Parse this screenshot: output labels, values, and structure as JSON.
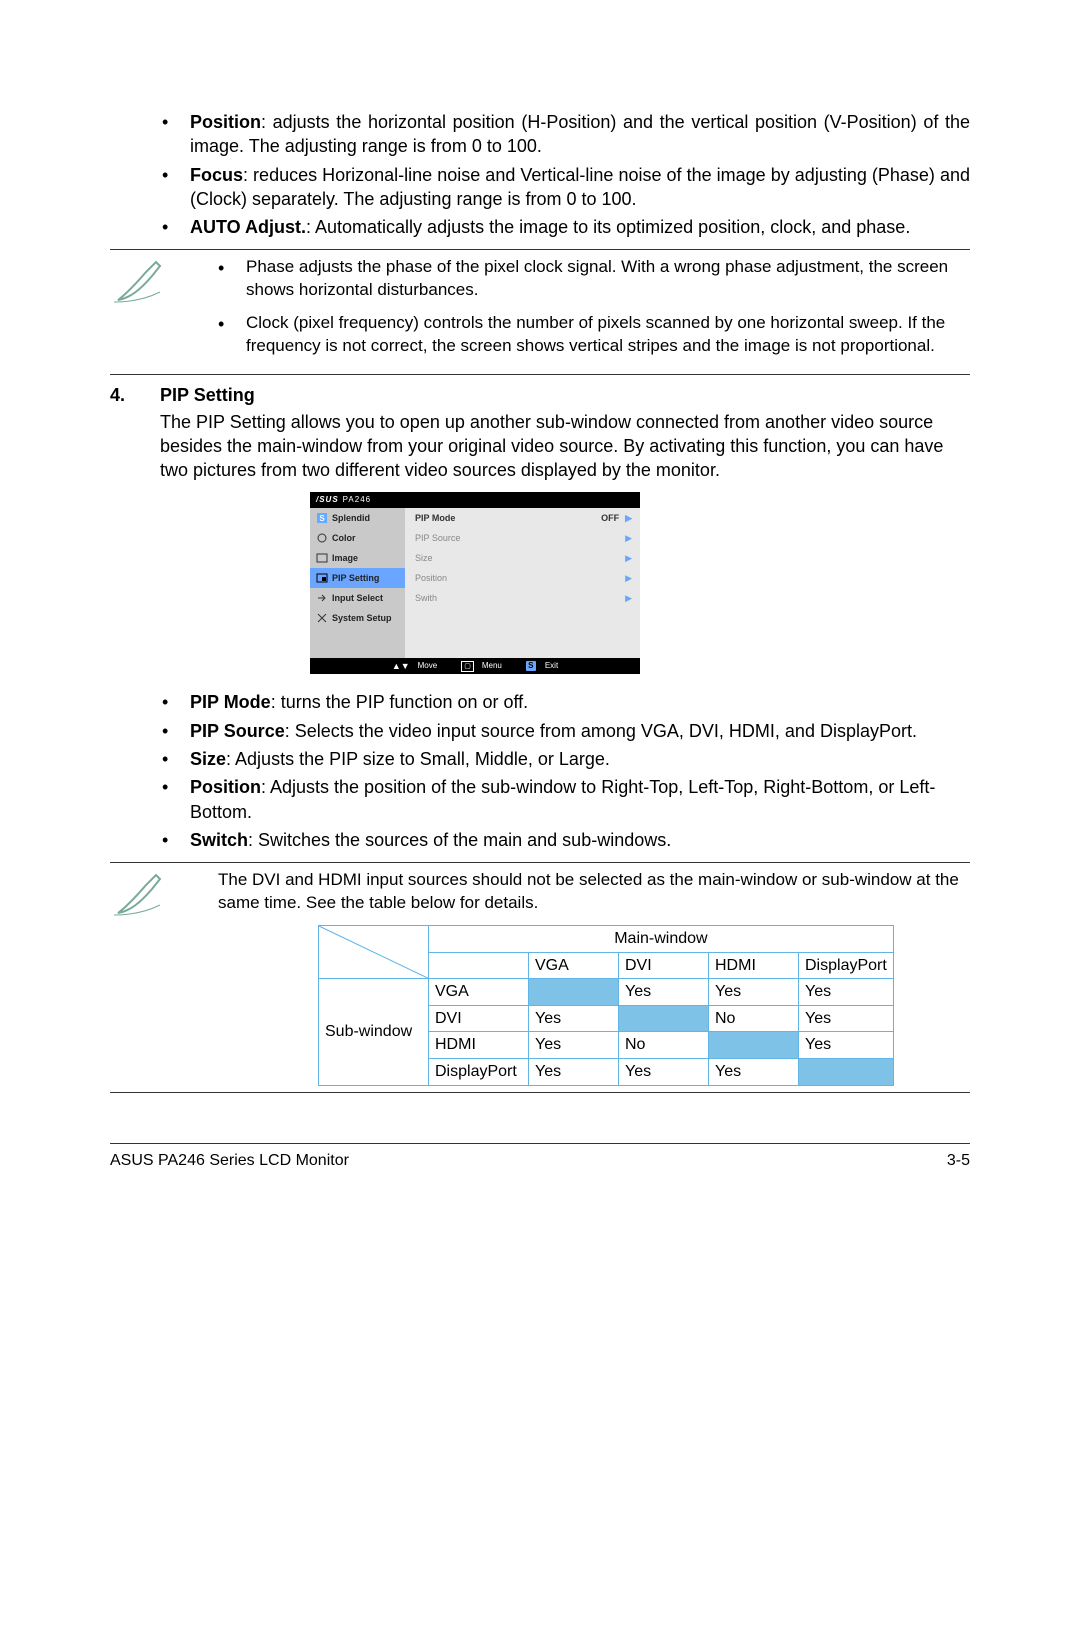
{
  "bullets1": [
    {
      "term": "Position",
      "text": ": adjusts the horizontal position (H-Position) and the vertical position (V-Position) of the image. The adjusting range is from 0 to 100."
    },
    {
      "term": "Focus",
      "text": ": reduces Horizonal-line noise and Vertical-line noise of the image by adjusting (Phase) and (Clock) separately. The adjusting range is from 0 to 100."
    },
    {
      "term": "AUTO Adjust.",
      "text": ": Automatically adjusts the image to its optimized position, clock, and phase."
    }
  ],
  "note1": [
    "Phase adjusts the phase of the pixel clock signal. With a wrong phase adjustment, the screen shows horizontal disturbances.",
    "Clock (pixel frequency) controls the number of pixels scanned by one horizontal sweep. If the frequency is not correct, the screen shows vertical stripes and the image is not proportional."
  ],
  "section": {
    "num": "4.",
    "title": "PIP Setting",
    "desc": "The PIP Setting allows you to open up another sub-window connected from another video source besides the main-window from your original video source. By activating this function, you can have two pictures from two different video sources displayed by the monitor."
  },
  "osd": {
    "brand": "/SUS",
    "model": "PA246",
    "left": [
      "Splendid",
      "Color",
      "Image",
      "PIP Setting",
      "Input Select",
      "System Setup"
    ],
    "selectedIndex": 3,
    "right": [
      {
        "label": "PIP Mode",
        "value": "OFF",
        "on": true
      },
      {
        "label": "PIP Source",
        "value": "",
        "on": false
      },
      {
        "label": "Size",
        "value": "",
        "on": false
      },
      {
        "label": "Position",
        "value": "",
        "on": false
      },
      {
        "label": "Swith",
        "value": "",
        "on": false
      }
    ],
    "bottom": {
      "move": "Move",
      "menu": "Menu",
      "exit": "Exit",
      "exitBadge": "S"
    }
  },
  "bullets2": [
    {
      "term": "PIP Mode",
      "text": ": turns the PIP function on or off."
    },
    {
      "term": "PIP Source",
      "text": ": Selects the video input source from among VGA, DVI, HDMI, and DisplayPort."
    },
    {
      "term": "Size",
      "text": ": Adjusts the PIP size to Small, Middle, or Large."
    },
    {
      "term": "Position",
      "text": ": Adjusts the position of the sub-window to Right-Top, Left-Top, Right-Bottom, or Left-Bottom."
    },
    {
      "term": "Switch",
      "text": ": Switches the sources of the main and sub-windows."
    }
  ],
  "note2": "The DVI and HDMI input sources should not be selected as the main-window or sub-window at the same time. See the table below for details.",
  "table": {
    "mainHeader": "Main-window",
    "subHeader": "Sub-window",
    "cols": [
      "VGA",
      "DVI",
      "HDMI",
      "DisplayPort"
    ],
    "rows": [
      {
        "name": "VGA",
        "cells": [
          "",
          "Yes",
          "Yes",
          "Yes"
        ],
        "fill": [
          0
        ]
      },
      {
        "name": "DVI",
        "cells": [
          "Yes",
          "",
          "No",
          "Yes"
        ],
        "fill": [
          1
        ]
      },
      {
        "name": "HDMI",
        "cells": [
          "Yes",
          "No",
          "",
          "Yes"
        ],
        "fill": [
          2
        ]
      },
      {
        "name": "DisplayPort",
        "cells": [
          "Yes",
          "Yes",
          "Yes",
          ""
        ],
        "fill": [
          3
        ]
      }
    ]
  },
  "footer": {
    "left": "ASUS PA246 Series LCD Monitor",
    "right": "3-5"
  }
}
